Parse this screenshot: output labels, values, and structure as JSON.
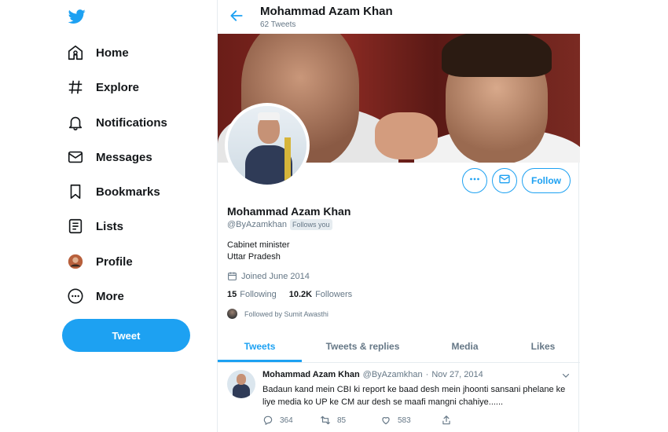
{
  "nav": {
    "items": [
      {
        "label": "Home",
        "icon": "home-icon"
      },
      {
        "label": "Explore",
        "icon": "hashtag-icon"
      },
      {
        "label": "Notifications",
        "icon": "bell-icon"
      },
      {
        "label": "Messages",
        "icon": "envelope-icon"
      },
      {
        "label": "Bookmarks",
        "icon": "bookmark-icon"
      },
      {
        "label": "Lists",
        "icon": "list-icon"
      },
      {
        "label": "Profile",
        "icon": "avatar-icon"
      },
      {
        "label": "More",
        "icon": "more-circle-icon"
      }
    ],
    "tweet_button": "Tweet"
  },
  "header": {
    "name": "Mohammad Azam Khan",
    "tweet_count": "62 Tweets"
  },
  "profile": {
    "name": "Mohammad Azam Khan",
    "handle": "@ByAzamkhan",
    "follows_you": "Follows you",
    "bio_line1": "Cabinet minister",
    "bio_line2": "Uttar Pradesh",
    "joined": "Joined June 2014",
    "following_count": "15",
    "following_label": "Following",
    "followers_count": "10.2K",
    "followers_label": "Followers",
    "followed_by": "Followed by Sumit Awasthi",
    "follow_button": "Follow"
  },
  "tabs": [
    {
      "label": "Tweets",
      "active": true
    },
    {
      "label": "Tweets & replies",
      "active": false
    },
    {
      "label": "Media",
      "active": false
    },
    {
      "label": "Likes",
      "active": false
    }
  ],
  "tweet": {
    "author": "Mohammad Azam Khan",
    "handle": "@ByAzamkhan",
    "separator": "·",
    "date": "Nov 27, 2014",
    "text": "Badaun kand mein CBI ki report ke baad desh mein jhoonti sansani phelane ke liye media ko UP ke CM aur desh se maafi mangni chahiye......",
    "replies": "364",
    "retweets": "85",
    "likes": "583"
  },
  "colors": {
    "accent": "#1da1f2",
    "text": "#14171a",
    "muted": "#657786",
    "border": "#e6ecf0"
  }
}
